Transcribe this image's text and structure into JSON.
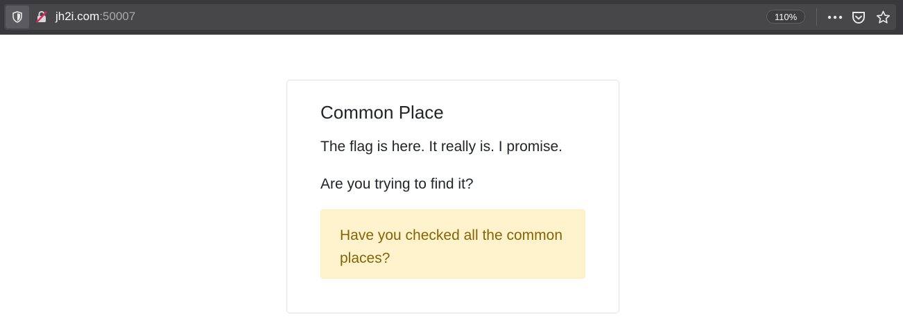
{
  "browser": {
    "url_host": "jh2i.com",
    "url_port": ":50007",
    "zoom": "110%",
    "icons": [
      "shield-icon",
      "insecure-lock-icon",
      "more-icon",
      "pocket-icon",
      "bookmark-star-icon"
    ]
  },
  "page": {
    "title": "Common Place",
    "line1": "The flag is here. It really is. I promise.",
    "line2": "Are you trying to find it?",
    "alert": "Have you checked all the common places?"
  },
  "colors": {
    "toolbar_bg": "#38383d",
    "alert_bg": "#fff3cd",
    "alert_text": "#856404",
    "text": "#212529"
  }
}
